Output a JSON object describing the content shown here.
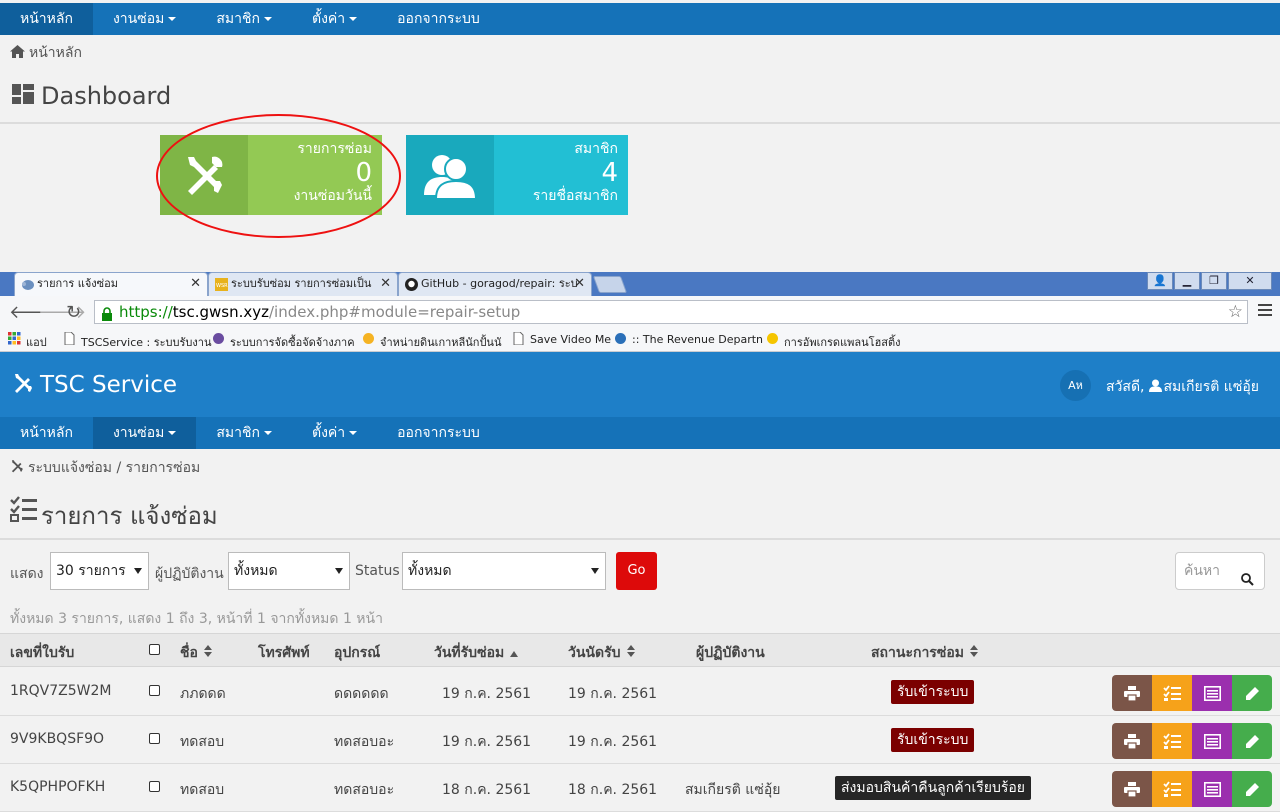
{
  "top": {
    "nav": [
      {
        "label": "หน้าหลัก",
        "active": true,
        "caret": false
      },
      {
        "label": "งานซ่อม",
        "active": false,
        "caret": true
      },
      {
        "label": "สมาชิก",
        "active": false,
        "caret": true
      },
      {
        "label": "ตั้งค่า",
        "active": false,
        "caret": true
      },
      {
        "label": "ออกจากระบบ",
        "active": false,
        "caret": false
      }
    ],
    "breadcrumb": "หน้าหลัก",
    "title": "Dashboard",
    "cards": [
      {
        "t1": "รายการซ่อม",
        "value": "0",
        "t3": "งานซ่อมวันนี้",
        "color": "#93c954",
        "icon_bg": "#7fb546",
        "icon": "tools-icon"
      },
      {
        "t1": "สมาชิก",
        "value": "4",
        "t3": "รายชื่อสมาชิก",
        "color": "#22bfd4",
        "icon_bg": "#19a9bd",
        "icon": "users-icon"
      }
    ]
  },
  "browser": {
    "tabs": [
      {
        "title": "รายการ แจ้งซ่อม",
        "active": true
      },
      {
        "title": "ระบบรับซ่อม รายการซ่อมเป็น",
        "active": false
      },
      {
        "title": "GitHub - goragod/repair: ระบ",
        "active": false
      }
    ],
    "url_scheme": "https://",
    "url_host": "tsc.gwsn.xyz",
    "url_path": "/index.php#module=repair-setup",
    "bookmarks": [
      "แอป",
      "TSCService : ระบบรับงาน",
      "ระบบการจัดซื้อจัดจ้างภาค",
      "จำหน่ายดินเกาหลีนักปั้นนั",
      "Save Video Me",
      ":: The Revenue Departn",
      "การอัพเกรดแพลนโฮสติ้ง"
    ]
  },
  "app": {
    "brand": "TSC Service",
    "lang": "Aห",
    "greeting": "สวัสดี,",
    "user": "สมเกียรติ แซ่อุ้ย",
    "nav": [
      {
        "label": "หน้าหลัก",
        "active": false,
        "caret": false
      },
      {
        "label": "งานซ่อม",
        "active": true,
        "caret": true
      },
      {
        "label": "สมาชิก",
        "active": false,
        "caret": true
      },
      {
        "label": "ตั้งค่า",
        "active": false,
        "caret": true
      },
      {
        "label": "ออกจากระบบ",
        "active": false,
        "caret": false
      }
    ],
    "breadcrumb": "ระบบแจ้งซ่อม / รายการซ่อม",
    "title": "รายการ แจ้งซ่อม",
    "filters": {
      "show_label": "แสดง",
      "show_value": "30 รายการ",
      "operator_label": "ผู้ปฏิบัติงาน",
      "operator_value": "ทั้งหมด",
      "status_label": "Status",
      "status_value": "ทั้งหมด",
      "go": "Go",
      "search_placeholder": "ค้นหา"
    },
    "summary": "ทั้งหมด 3 รายการ, แสดง 1 ถึง 3, หน้าที่ 1 จากทั้งหมด 1 หน้า",
    "columns": {
      "job_no": "เลขที่ใบรับ",
      "name": "ชื่อ",
      "phone": "โทรศัพท์",
      "device": "อุปกรณ์",
      "received": "วันที่รับซ่อม",
      "appointment": "วันนัดรับ",
      "operator": "ผู้ปฏิบัติงาน",
      "status": "สถานะการซ่อม"
    },
    "rows": [
      {
        "job_no": "1RQV7Z5W2M",
        "name": "ภภดดด",
        "phone": "",
        "device": "ดดดดดด",
        "received": "19 ก.ค. 2561",
        "appointment": "19 ก.ค. 2561",
        "operator": "",
        "status": "รับเข้าระบบ",
        "status_color": "#7b0000"
      },
      {
        "job_no": "9V9KBQSF9O",
        "name": "ทดสอบ",
        "phone": "",
        "device": "ทดสอบอะ",
        "received": "19 ก.ค. 2561",
        "appointment": "19 ก.ค. 2561",
        "operator": "",
        "status": "รับเข้าระบบ",
        "status_color": "#7b0000"
      },
      {
        "job_no": "K5QPHPOFKH",
        "name": "ทดสอบ",
        "phone": "",
        "device": "ทดสอบอะ",
        "received": "18 ก.ค. 2561",
        "appointment": "18 ก.ค. 2561",
        "operator": "สมเกียรติ แซ่อุ้ย",
        "status": "ส่งมอบสินค้าคืนลูกค้าเรียบร้อย",
        "status_color": "#262626"
      }
    ],
    "action_colors": {
      "print": "#7b5548",
      "checklist": "#f6a21a",
      "detail": "#9b2fae",
      "edit": "#45ad4c"
    }
  }
}
